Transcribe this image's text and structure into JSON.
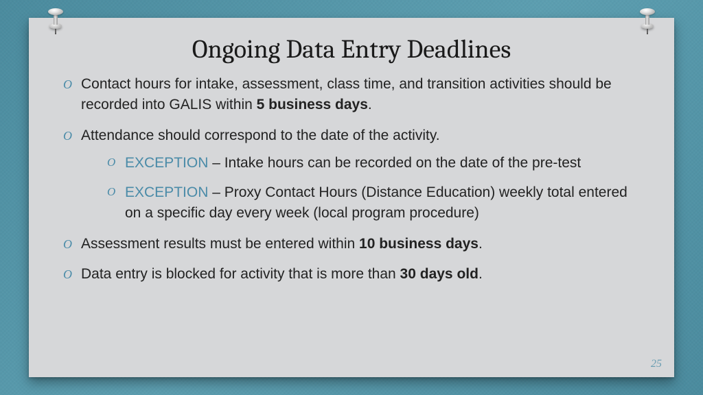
{
  "title": "Ongoing Data Entry Deadlines",
  "bullets": [
    {
      "pre": "Contact hours for intake, assessment, class time, and transition activities should be recorded into GALIS within ",
      "bold": "5 business days",
      "post": "."
    },
    {
      "pre": "Attendance should correspond to the date of the activity.",
      "bold": "",
      "post": "",
      "sub": [
        {
          "label": "EXCEPTION",
          "text": " – Intake hours can be recorded on the date of the pre-test"
        },
        {
          "label": "EXCEPTION",
          "text": " – Proxy Contact Hours (Distance Education) weekly total entered on a specific day every week (local program procedure)"
        }
      ]
    },
    {
      "pre": "Assessment results must be entered within ",
      "bold": "10 business days",
      "post": "."
    },
    {
      "pre": "Data entry is blocked for activity that is more than ",
      "bold": "30 days old",
      "post": "."
    }
  ],
  "pageNumber": "25",
  "colors": {
    "accent": "#4a8ba8",
    "slideBg": "#d6d7d9",
    "boardBg": "#5596a8"
  }
}
